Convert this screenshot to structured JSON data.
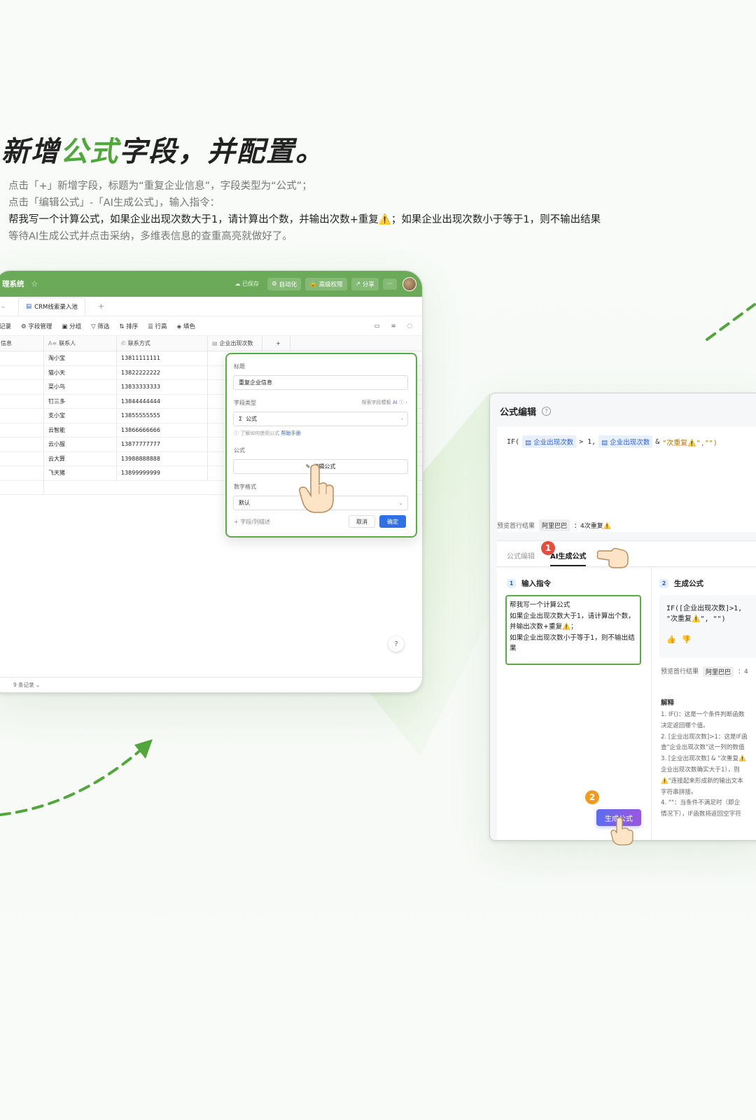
{
  "hero": {
    "title_a": "新增",
    "title_accent": "公式",
    "title_b": "字段，并配置。",
    "lines": [
      "点击「+」新增字段，标题为“重复企业信息”，字段类型为“公式”；",
      "点击「编辑公式」-「AI生成公式」，输入指令：",
      "帮我写一个计算公式，如果企业出现次数大于1，请计算出个数，并输出次数+重复⚠️；如果企业出现次数小于等于1，则不输出结果",
      "等待AI生成公式并点击采纳，多维表信息的查重高亮就做好了。"
    ]
  },
  "left_window": {
    "app_name": "理系统",
    "saved": "已保存",
    "buttons": [
      "自动化",
      "高级权限",
      "分享"
    ],
    "more": "···",
    "tab_label": "CRM线索录入池",
    "tab_add": "+",
    "toolbar": [
      "记录",
      "字段管理",
      "分组",
      "筛选",
      "排序",
      "行高",
      "填色"
    ],
    "columns": [
      "信息",
      "联系人",
      "联系方式",
      "企业出现次数",
      "+"
    ],
    "rows": [
      {
        "name": "淘小宝",
        "phone": "13811111111"
      },
      {
        "name": "猫小天",
        "phone": "13822222222"
      },
      {
        "name": "菜小鸟",
        "phone": "13833333333"
      },
      {
        "name": "钉三多",
        "phone": "13844444444"
      },
      {
        "name": "支小宝",
        "phone": "13855555555"
      },
      {
        "name": "云智能",
        "phone": "13866666666"
      },
      {
        "name": "云小服",
        "phone": "13877777777"
      },
      {
        "name": "云大算",
        "phone": "13988888888"
      },
      {
        "name": "飞天猪",
        "phone": "13899999999"
      }
    ],
    "footer": "9 条记录",
    "help": "?"
  },
  "field_popup": {
    "title_label": "标题",
    "title_value": "重复企业信息",
    "type_label": "字段类型",
    "type_hint": "探索字段模板",
    "type_ai": "AI",
    "type_value": "公式",
    "help_text": "了解如何使用公式",
    "help_link": "帮助手册",
    "formula_label": "公式",
    "edit_formula": "编辑公式",
    "number_format_label": "数字格式",
    "number_format_value": "默认",
    "add_desc": "+ 字段/列描述",
    "cancel": "取消",
    "confirm": "确定"
  },
  "formula_panel": {
    "title": "公式编辑",
    "help": "?",
    "code": {
      "fn_open": "IF(",
      "field1": "企业出现次数",
      "op": "> 1,",
      "field2": "企业出现次数",
      "amp": "&",
      "str": "\"次重复⚠️\",\"\")"
    },
    "preview_label": "预览首行结果",
    "preview_tag": "阿里巴巴",
    "preview_value": "：4次重复⚠️",
    "tabs": [
      "公式编辑",
      "AI生成公式"
    ],
    "step1_num": "1",
    "step1_title": "输入指令",
    "instruction": "帮我写一个计算公式\n如果企业出现次数大于1，请计算出个数，并输出次数+重复⚠️；\n如果企业出现次数小于等于1，则不输出结果",
    "step2_num": "2",
    "step2_title": "生成公式",
    "generated_line1": "IF([企业出现次数]>1,",
    "generated_line2": "\"次重复⚠️\", \"\")",
    "preview2_label": "预览首行结果",
    "preview2_tag": "阿里巴巴",
    "preview2_value": "：4",
    "explain_title": "解释",
    "explain_lines": [
      "1. IF()：这是一个条件判断函数",
      "决定返回哪个值。",
      "2. [企业出现次数]>1：这是IF函",
      "查\"企业出现次数\"这一列的数值",
      "3. [企业出现次数] & \"次重复⚠️",
      "企业出现次数确实大于1），则",
      "⚠️\"连接起来形成新的输出文本",
      "字符串拼接。",
      "4. \"\"：当条件不满足时（即企",
      "情况下），IF函数将返回空字符"
    ],
    "generate_button": "生成公式"
  },
  "badges": [
    "1",
    "2"
  ],
  "colors": {
    "accent_green": "#4ea83a",
    "titlebar_green": "#6aaa58",
    "badge_red": "#e84c3d",
    "badge_orange": "#f39a1e",
    "gen_gradient_start": "#5b6df0",
    "gen_gradient_end": "#9a56e0"
  }
}
